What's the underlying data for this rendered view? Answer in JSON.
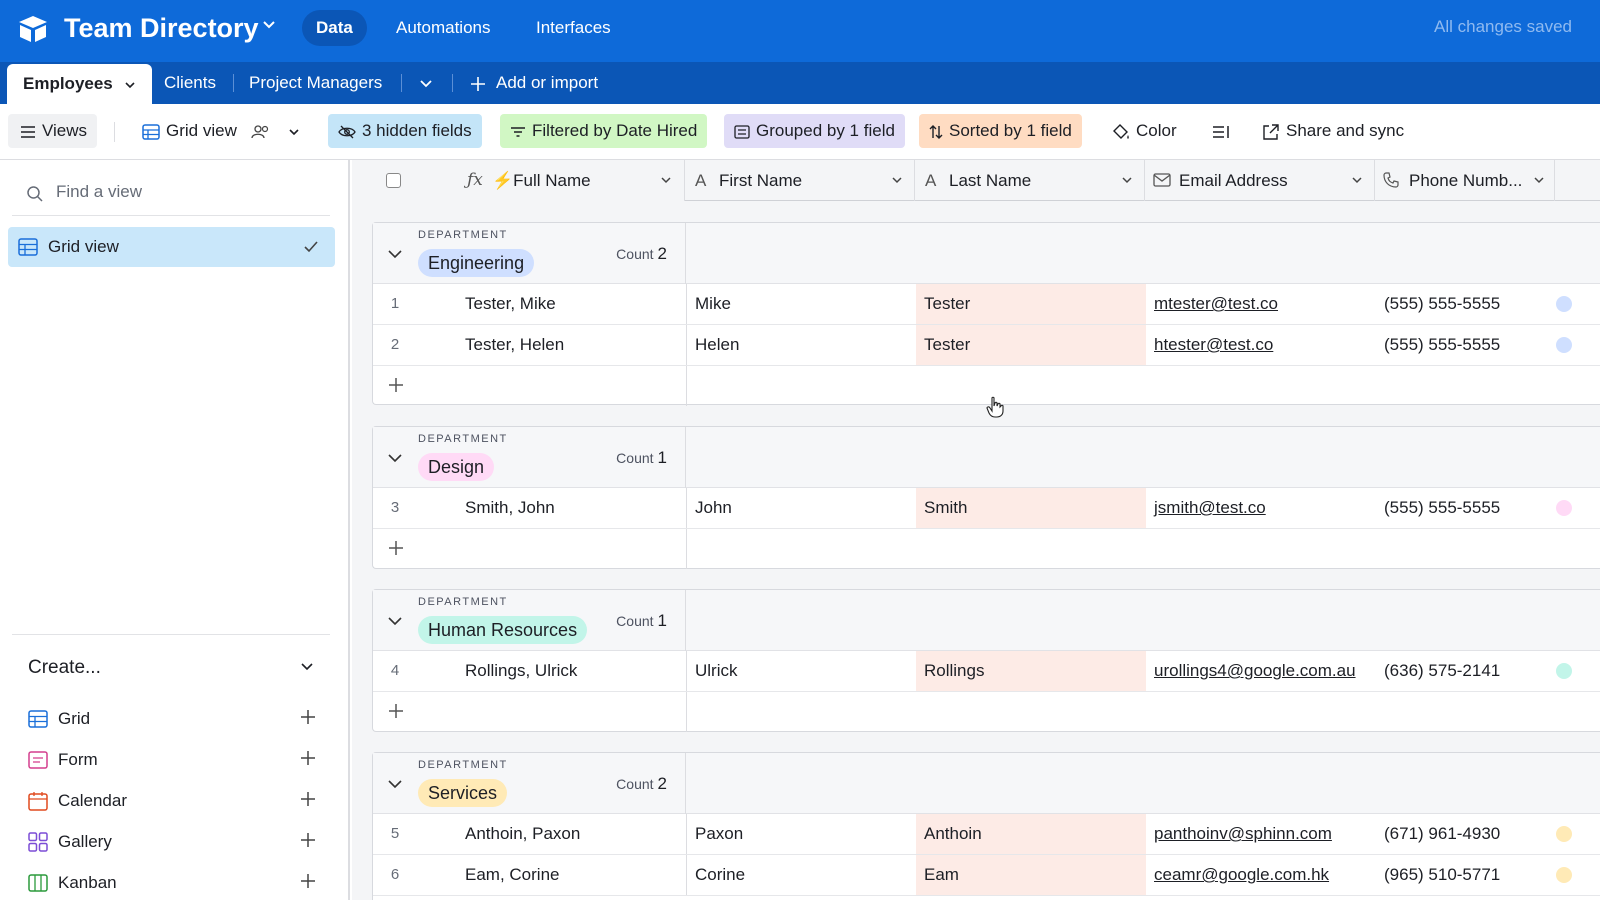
{
  "app": {
    "base_title": "Team Directory",
    "nav": {
      "data": "Data",
      "automations": "Automations",
      "interfaces": "Interfaces"
    },
    "status": "All changes saved",
    "colors": {
      "topbar": "#0e6ad9",
      "tabbar": "#0b56b6"
    }
  },
  "tables": {
    "active": "Employees",
    "clients": "Clients",
    "project_managers": "Project Managers",
    "add": "Add or import"
  },
  "toolbar": {
    "views": "Views",
    "view_name": "Grid view",
    "hidden": "3 hidden fields",
    "filter": "Filtered by Date Hired",
    "group": "Grouped by 1 field",
    "sort": "Sorted by 1 field",
    "color": "Color",
    "share": "Share and sync"
  },
  "sidebar": {
    "find_placeholder": "Find a view",
    "views": [
      {
        "label": "Grid view"
      }
    ],
    "create_title": "Create...",
    "create_items": [
      {
        "label": "Grid",
        "icon": "grid-icon"
      },
      {
        "label": "Form",
        "icon": "form-icon"
      },
      {
        "label": "Calendar",
        "icon": "calendar-icon"
      },
      {
        "label": "Gallery",
        "icon": "gallery-icon"
      },
      {
        "label": "Kanban",
        "icon": "kanban-icon"
      }
    ]
  },
  "columns": {
    "full_name": "⚡Full Name",
    "first_name": "First Name",
    "last_name": "Last Name",
    "email": "Email Address",
    "phone": "Phone Numb..."
  },
  "groups": [
    {
      "label": "DEPARTMENT",
      "name": "Engineering",
      "count_label": "Count",
      "count": "2",
      "color": "#cfdfff",
      "rows": [
        {
          "num": "1",
          "full": "Tester, Mike",
          "first": "Mike",
          "last": "Tester",
          "email": "mtester@test.co",
          "phone": "(555) 555-5555"
        },
        {
          "num": "2",
          "full": "Tester, Helen",
          "first": "Helen",
          "last": "Tester",
          "email": "htester@test.co",
          "phone": "(555) 555-5555"
        }
      ]
    },
    {
      "label": "DEPARTMENT",
      "name": "Design",
      "count_label": "Count",
      "count": "1",
      "color": "#ffdaf6",
      "rows": [
        {
          "num": "3",
          "full": "Smith, John",
          "first": "John",
          "last": "Smith",
          "email": "jsmith@test.co",
          "phone": "(555) 555-5555"
        }
      ]
    },
    {
      "label": "DEPARTMENT",
      "name": "Human Resources",
      "count_label": "Count",
      "count": "1",
      "color": "#c2f5e9",
      "rows": [
        {
          "num": "4",
          "full": "Rollings, Ulrick",
          "first": "Ulrick",
          "last": "Rollings",
          "email": "urollings4@google.com.au",
          "phone": "(636) 575-2141"
        }
      ]
    },
    {
      "label": "DEPARTMENT",
      "name": "Services",
      "count_label": "Count",
      "count": "2",
      "color": "#ffeab6",
      "rows": [
        {
          "num": "5",
          "full": "Anthoin, Paxon",
          "first": "Paxon",
          "last": "Anthoin",
          "email": "panthoinv@sphinn.com",
          "phone": "(671) 961-4930"
        },
        {
          "num": "6",
          "full": "Eam, Corine",
          "first": "Corine",
          "last": "Eam",
          "email": "ceamr@google.com.hk",
          "phone": "(965) 510-5771"
        }
      ]
    }
  ]
}
